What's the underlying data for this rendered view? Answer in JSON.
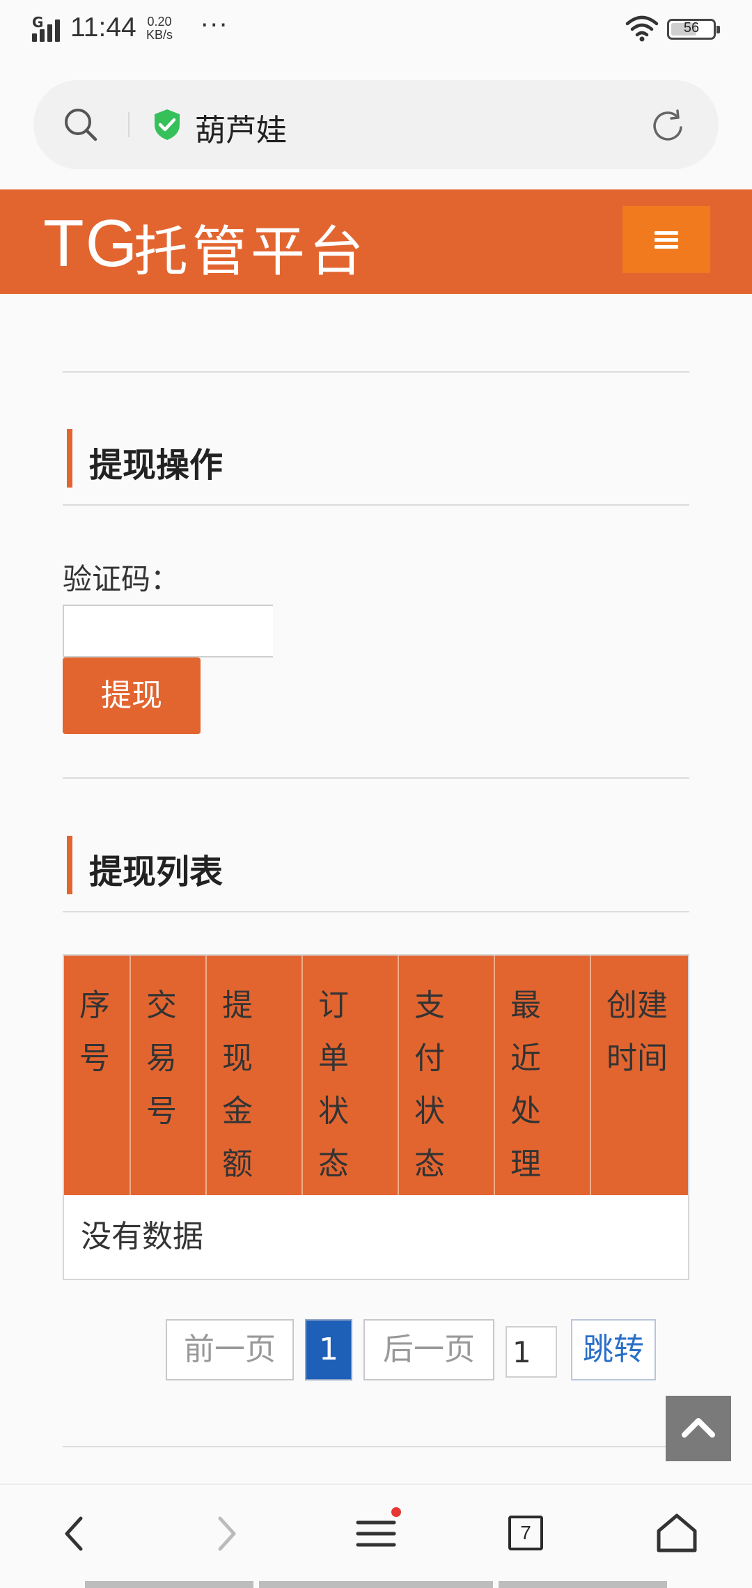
{
  "status_bar": {
    "network_type": "G",
    "time": "11:44",
    "net_speed_value": "0.20",
    "net_speed_unit": "KB/s",
    "more": "···",
    "battery_level": "56"
  },
  "address_bar": {
    "site_title": "葫芦娃"
  },
  "header": {
    "logo_tg": "TG",
    "logo_text": "托管平台"
  },
  "withdraw_section": {
    "title": "提现操作",
    "captcha_label": "验证码：",
    "captcha_value": "",
    "submit_label": "提现"
  },
  "list_section": {
    "title": "提现列表",
    "columns": [
      "序号",
      "交易号",
      "提现金额",
      "订单状态",
      "支付状态",
      "最近处理",
      "创建时间"
    ],
    "empty_text": "没有数据"
  },
  "pagination": {
    "prev_label": "前一页",
    "current_page": "1",
    "next_label": "后一页",
    "jump_value": "1",
    "jump_label": "跳转"
  },
  "bottom_nav": {
    "tabs_count": "7"
  },
  "colors": {
    "brand_orange": "#e26530",
    "menu_orange": "#f07a1d",
    "page_active_blue": "#1e5fb8"
  }
}
